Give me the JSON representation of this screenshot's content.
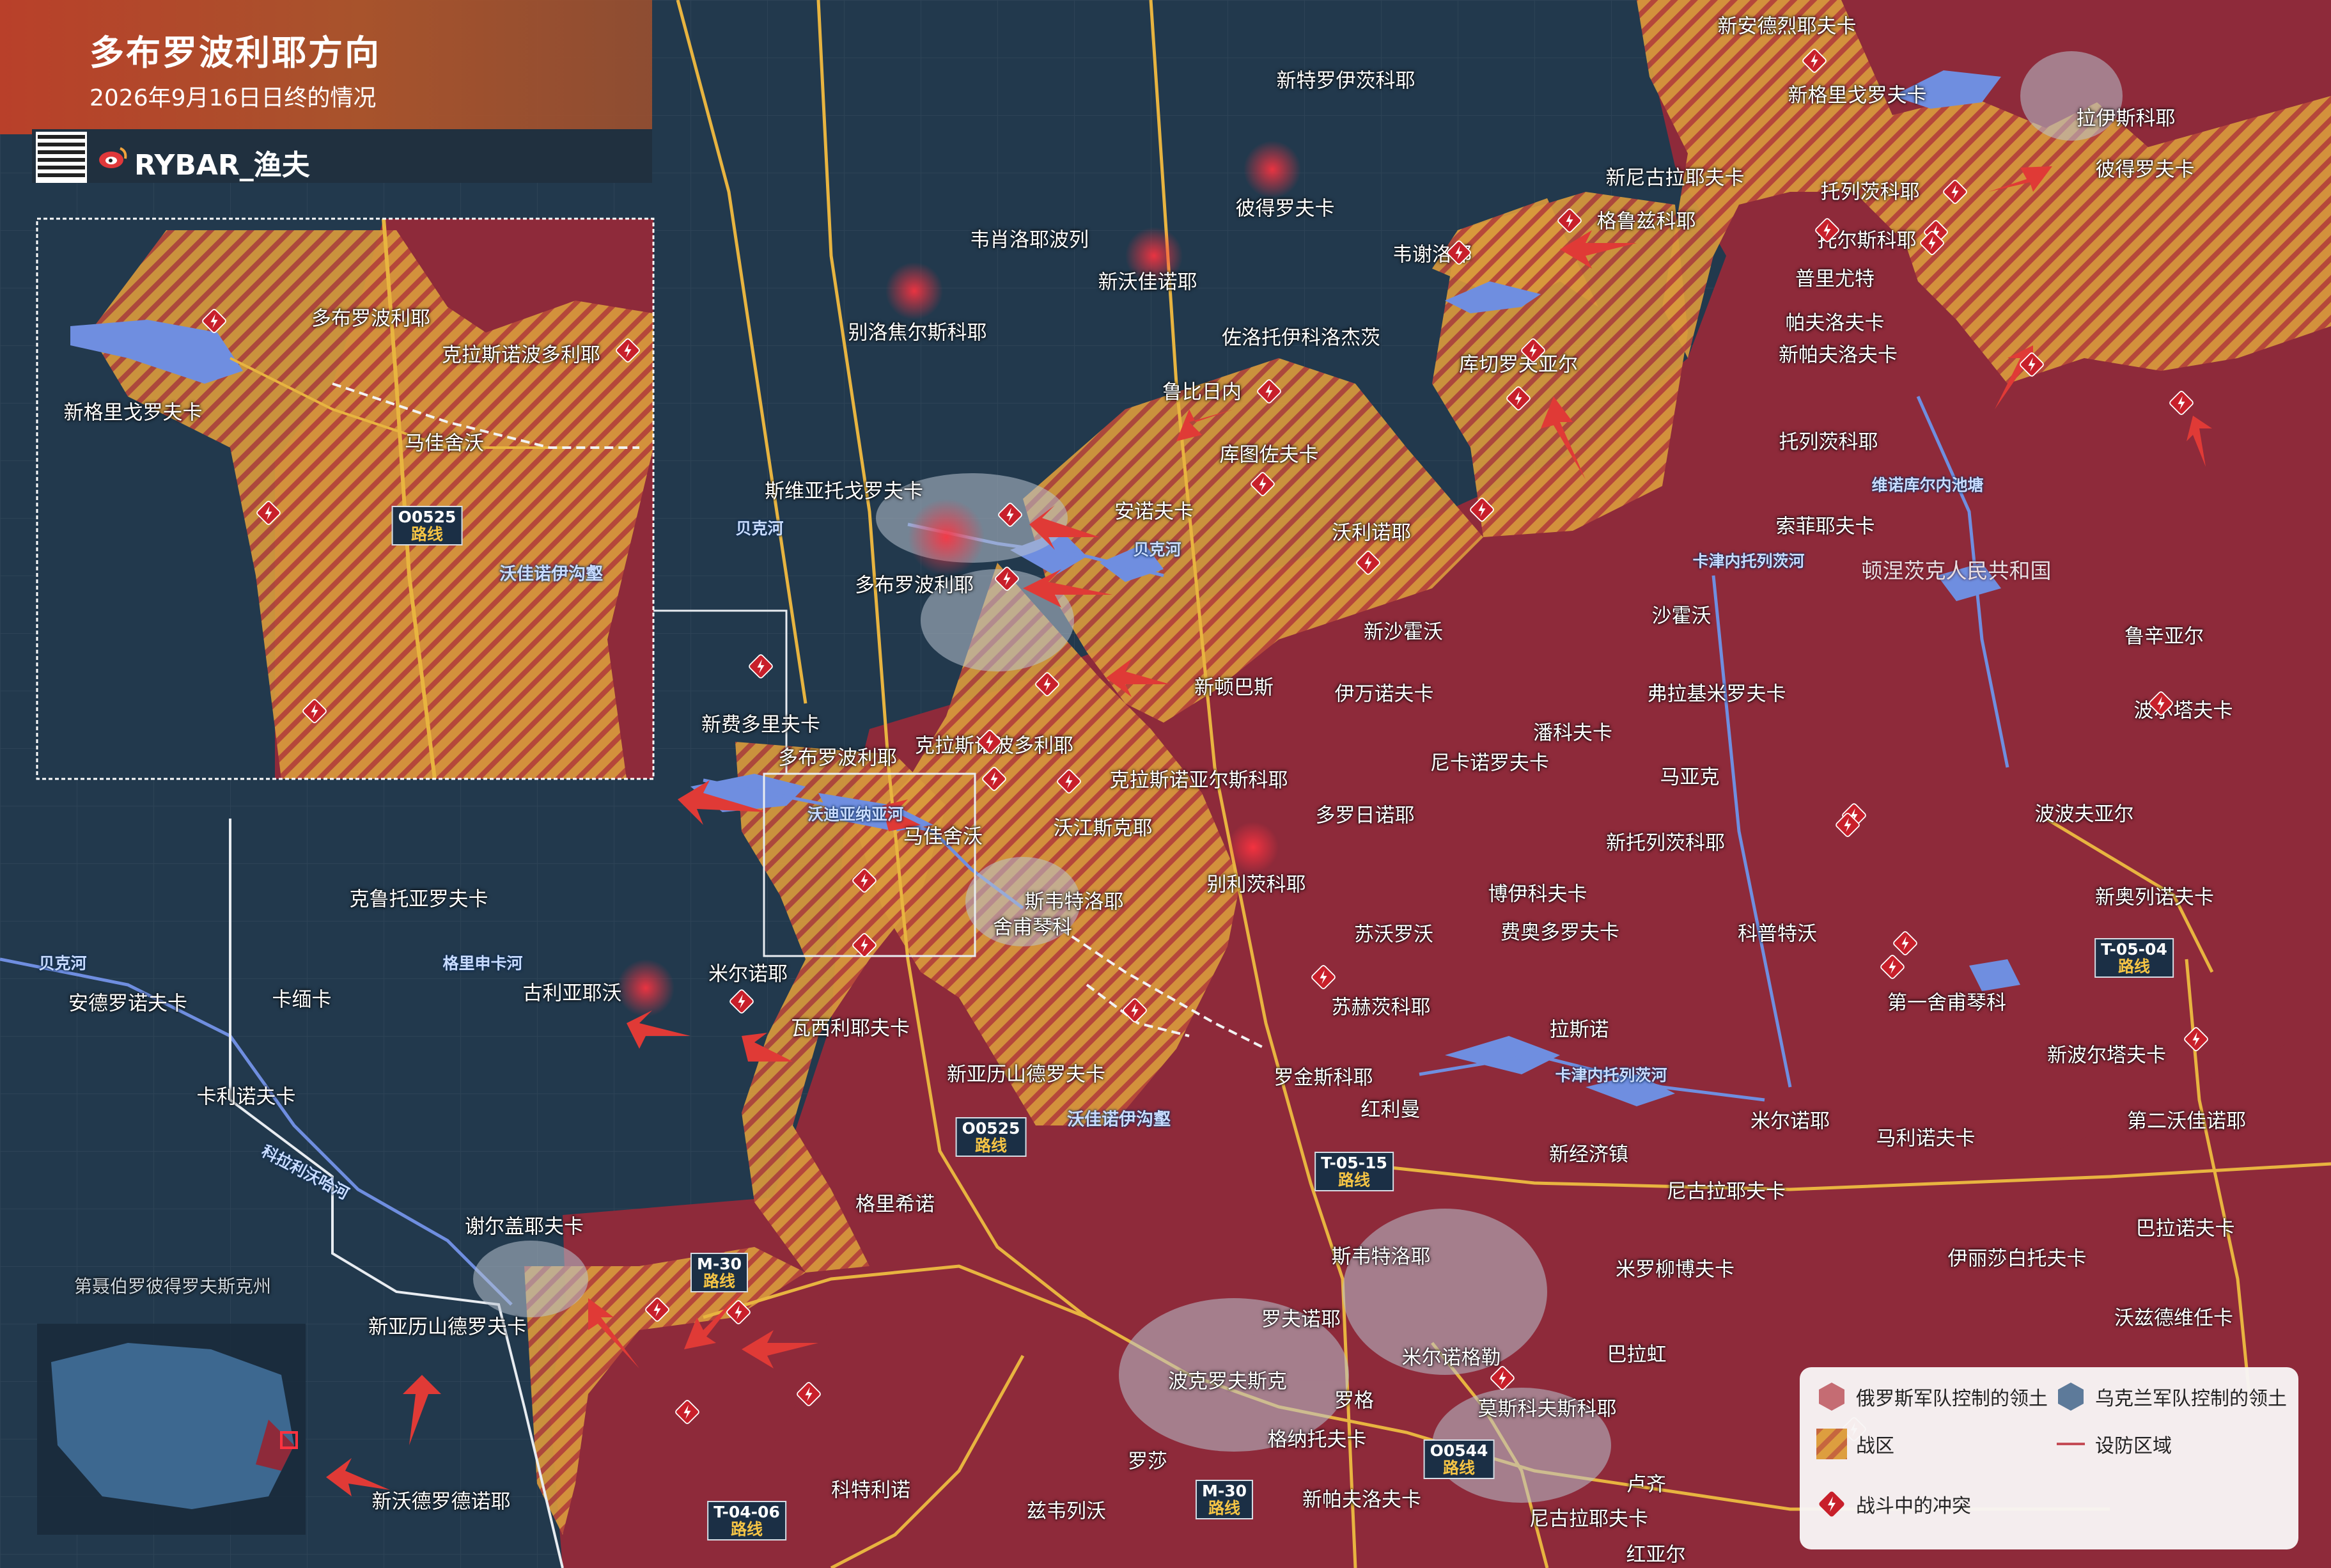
{
  "header": {
    "title": "多布罗波利耶方向",
    "subtitle": "2026年9月16日日终的情况",
    "brand": "RYBAR_渔夫"
  },
  "colors": {
    "ukraine_territory": "#22394d",
    "russia_territory": "#8e2a3a",
    "combat_zone": "#d99a3c",
    "clash_marker": "#c81f2a",
    "roads": "#e8b440",
    "water": "#6f8ee0"
  },
  "inset_labels": {
    "dobropillia": "多布罗波利耶",
    "kranopillia": "克拉斯诺波多利耶",
    "nova_hryhorivka": "新格里戈罗夫卡",
    "mayak": "马佳舍沃",
    "road_o0525": "O0525",
    "road_word": "路线",
    "ravine": "沃佳诺伊沟壑"
  },
  "places": [
    {
      "id": "novoandriivka",
      "name": "新安德烈耶夫卡"
    },
    {
      "id": "novohryhorivka_ne",
      "name": "新格里戈罗夫卡"
    },
    {
      "id": "radionivka",
      "name": "拉伊斯科耶"
    },
    {
      "id": "novotroyizke",
      "name": "新特罗伊茨科耶"
    },
    {
      "id": "petrivka1",
      "name": "彼得罗夫卡"
    },
    {
      "id": "petrivka2",
      "name": "彼得罗夫卡"
    },
    {
      "id": "novomykolaivka",
      "name": "新尼古拉耶夫卡"
    },
    {
      "id": "toretskyi",
      "name": "托列茨科耶"
    },
    {
      "id": "veseloe",
      "name": "韦肖洛耶波列"
    },
    {
      "id": "novovasylivka",
      "name": "新沃佳诺耶"
    },
    {
      "id": "hruzke",
      "name": "格鲁兹科耶"
    },
    {
      "id": "torske",
      "name": "托尔斯科耶"
    },
    {
      "id": "veselyi",
      "name": "韦谢洛耶"
    },
    {
      "id": "pryvilne",
      "name": "普里尤特"
    },
    {
      "id": "bilozerske",
      "name": "别洛焦尔斯科耶"
    },
    {
      "id": "zolotyi",
      "name": "佐洛托伊科洛杰茨"
    },
    {
      "id": "pavlivka",
      "name": "帕夫洛夫卡"
    },
    {
      "id": "kucheriv",
      "name": "库切罗夫亚尔"
    },
    {
      "id": "novopavlivka",
      "name": "新帕夫洛夫卡"
    },
    {
      "id": "rubizhne",
      "name": "鲁比日内"
    },
    {
      "id": "kutuzivka",
      "name": "库图佐夫卡"
    },
    {
      "id": "toretske2",
      "name": "托列茨科耶"
    },
    {
      "id": "sviatohorivka",
      "name": "斯维亚托戈罗夫卡"
    },
    {
      "id": "anna",
      "name": "安诺夫卡"
    },
    {
      "id": "sofiivka",
      "name": "索菲耶夫卡"
    },
    {
      "id": "dobropillia",
      "name": "多布罗波利耶"
    },
    {
      "id": "volodymyrivka",
      "name": "沃利诺耶"
    },
    {
      "id": "novoshakhove",
      "name": "新沙霍沃"
    },
    {
      "id": "shakhove",
      "name": "沙霍沃"
    },
    {
      "id": "rusyn",
      "name": "鲁辛亚尔"
    },
    {
      "id": "novodonetske",
      "name": "新顿巴斯"
    },
    {
      "id": "ivanivka",
      "name": "伊万诺夫卡"
    },
    {
      "id": "vladimirov",
      "name": "弗拉基米罗夫卡"
    },
    {
      "id": "poltavka",
      "name": "波尔塔夫卡"
    },
    {
      "id": "novofedorivka",
      "name": "新费多里夫卡"
    },
    {
      "id": "dobropillia2",
      "name": "多布罗波利耶"
    },
    {
      "id": "krasnopodilske",
      "name": "克拉斯诺波多利耶"
    },
    {
      "id": "krasnoarmiiske",
      "name": "克拉斯诺亚尔斯科耶"
    },
    {
      "id": "pankivka",
      "name": "潘科夫卡"
    },
    {
      "id": "nikanorivka",
      "name": "尼卡诺罗夫卡"
    },
    {
      "id": "maiak",
      "name": "马亚克"
    },
    {
      "id": "vodianske",
      "name": "沃江斯克耶"
    },
    {
      "id": "mayakhove",
      "name": "马佳舍沃"
    },
    {
      "id": "dorozhne",
      "name": "多罗日诺耶"
    },
    {
      "id": "bilytske",
      "name": "别利茨科耶"
    },
    {
      "id": "novotoretske",
      "name": "新托列茨科耶"
    },
    {
      "id": "popov",
      "name": "波波夫亚尔"
    },
    {
      "id": "svyatohirske",
      "name": "斯韦特洛耶"
    },
    {
      "id": "shevchenko",
      "name": "舍甫琴科"
    },
    {
      "id": "boiko",
      "name": "博伊科夫卡"
    },
    {
      "id": "fedorivka",
      "name": "费奥多罗夫卡"
    },
    {
      "id": "suvorove",
      "name": "苏沃罗沃"
    },
    {
      "id": "kiprove",
      "name": "科普特沃"
    },
    {
      "id": "novoolenivka",
      "name": "新奥列诺夫卡"
    },
    {
      "id": "krutoiarivka",
      "name": "克鲁托亚罗夫卡"
    },
    {
      "id": "myrnohrad",
      "name": "米尔诺耶"
    },
    {
      "id": "hrushivka",
      "name": "古利亚耶沃"
    },
    {
      "id": "kalynove",
      "name": "卡缅卡"
    },
    {
      "id": "andriivka",
      "name": "安德罗诺夫卡"
    },
    {
      "id": "vasylivka",
      "name": "瓦西利耶夫卡"
    },
    {
      "id": "suhetske",
      "name": "苏赫茨科耶"
    },
    {
      "id": "lastochkyne",
      "name": "拉斯诺"
    },
    {
      "id": "sheremetyevo",
      "name": "第一舍甫琴科"
    },
    {
      "id": "novoleksandrivka",
      "name": "新亚历山德罗夫卡"
    },
    {
      "id": "rodynske",
      "name": "罗金斯科耶"
    },
    {
      "id": "novopoltavka",
      "name": "新波尔塔夫卡"
    },
    {
      "id": "chervonyi",
      "name": "红利曼"
    },
    {
      "id": "kalynivka",
      "name": "卡利诺夫卡"
    },
    {
      "id": "novoekonomichne",
      "name": "新经济镇"
    },
    {
      "id": "myrne",
      "name": "米尔诺耶"
    },
    {
      "id": "malynivka",
      "name": "马利诺夫卡"
    },
    {
      "id": "druha",
      "name": "第二沃佳诺耶"
    },
    {
      "id": "hryshyne",
      "name": "格里希诺"
    },
    {
      "id": "nykolaivka",
      "name": "尼古拉耶夫卡"
    },
    {
      "id": "sergiivka",
      "name": "谢尔盖耶夫卡"
    },
    {
      "id": "shevchenko2",
      "name": "斯韦特洛耶"
    },
    {
      "id": "myrnolyub",
      "name": "米罗柳博夫卡"
    },
    {
      "id": "lysychansk",
      "name": "伊丽莎白托夫卡"
    },
    {
      "id": "barvinok",
      "name": "巴拉诺夫卡"
    },
    {
      "id": "novoaleksandrivka2",
      "name": "新亚历山德罗夫卡"
    },
    {
      "id": "rivne",
      "name": "罗夫诺耶"
    },
    {
      "id": "myrnohrad2",
      "name": "米尔诺格勒"
    },
    {
      "id": "barakh",
      "name": "巴拉虹"
    },
    {
      "id": "zvirove",
      "name": "沃兹德维任卡"
    },
    {
      "id": "pokrovsk",
      "name": "波克罗夫斯克"
    },
    {
      "id": "moskovskyi",
      "name": "莫斯科夫斯科耶"
    },
    {
      "id": "rih",
      "name": "罗格"
    },
    {
      "id": "hnativka",
      "name": "格纳托夫卡"
    },
    {
      "id": "rossa",
      "name": "罗莎"
    },
    {
      "id": "kotlyne",
      "name": "科特利诺"
    },
    {
      "id": "lucheske",
      "name": "卢齐"
    },
    {
      "id": "novopavlivka2",
      "name": "新帕夫洛夫卡"
    },
    {
      "id": "zvirivka",
      "name": "兹韦列沃"
    },
    {
      "id": "novovodyane",
      "name": "新沃德罗德诺耶"
    },
    {
      "id": "nikolaiv2",
      "name": "尼古拉耶夫卡"
    },
    {
      "id": "krasnyi",
      "name": "红亚尔"
    }
  ],
  "water_labels": {
    "bykovyi1": "贝克河",
    "bykovyi2": "贝克河",
    "bykovyi3": "贝克河",
    "vodianskaya": "沃迪亚纳亚河",
    "kazennyi1": "卡津内托列茨河",
    "kazennyi2": "卡津内托列茨河",
    "mokra": "格里申卡河",
    "kryvyi": "科拉利沃哈河",
    "lake": "维诺库尔内池塘"
  },
  "ravine": "沃佳诺伊沟壑",
  "regions": {
    "dnr": "顿涅茨克人民共和国",
    "dnipro": "第聂伯罗彼得罗夫斯克州"
  },
  "roads": [
    {
      "id": "o0525a",
      "code": "O0525",
      "word": "路线"
    },
    {
      "id": "t0515",
      "code": "T-05-15",
      "word": "路线"
    },
    {
      "id": "t0504",
      "code": "T-05-04",
      "word": "路线"
    },
    {
      "id": "m30a",
      "code": "M-30",
      "word": "路线"
    },
    {
      "id": "m30b",
      "code": "M-30",
      "word": "路线"
    },
    {
      "id": "o0544",
      "code": "O0544",
      "word": "路线"
    },
    {
      "id": "t0406",
      "code": "T-04-06",
      "word": "路线"
    }
  ],
  "legend": {
    "russia": "俄罗斯军队控制的领土",
    "ukraine": "乌克兰军队控制的领土",
    "combat": "战区",
    "defense": "设防区域",
    "clash": "战斗中的冲突"
  }
}
